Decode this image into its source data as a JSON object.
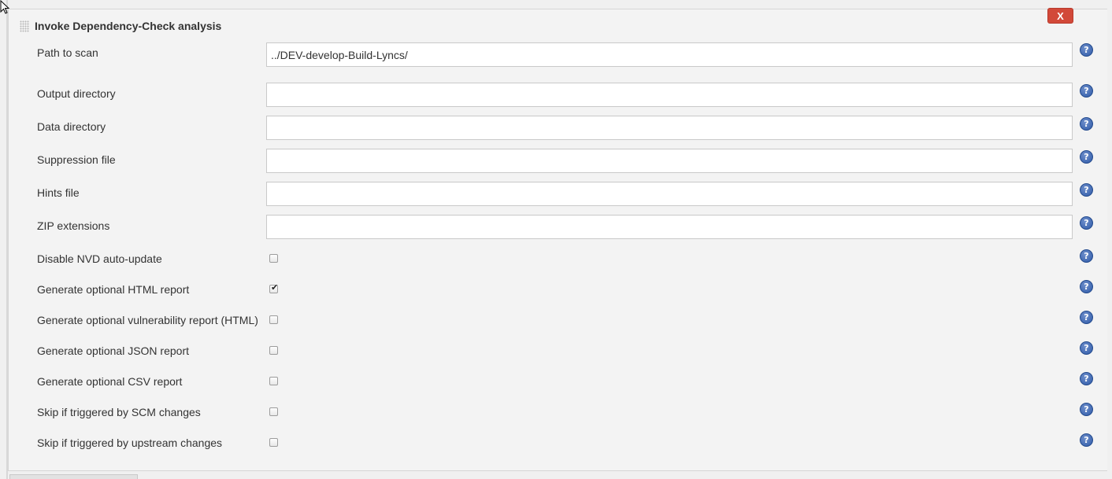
{
  "section": {
    "title": "Invoke Dependency-Check analysis",
    "delete_label": "X"
  },
  "text_fields": [
    {
      "label": "Path to scan",
      "value": "../DEV-develop-Build-Lyncs/"
    },
    {
      "label": "Output directory",
      "value": ""
    },
    {
      "label": "Data directory",
      "value": ""
    },
    {
      "label": "Suppression file",
      "value": ""
    },
    {
      "label": "Hints file",
      "value": ""
    },
    {
      "label": "ZIP extensions",
      "value": ""
    }
  ],
  "checkboxes": [
    {
      "label": "Disable NVD auto-update",
      "checked": false
    },
    {
      "label": "Generate optional HTML report",
      "checked": true
    },
    {
      "label": "Generate optional vulnerability report (HTML)",
      "checked": false
    },
    {
      "label": "Generate optional JSON report",
      "checked": false
    },
    {
      "label": "Generate optional CSV report",
      "checked": false
    },
    {
      "label": "Skip if triggered by SCM changes",
      "checked": false
    },
    {
      "label": "Skip if triggered by upstream changes",
      "checked": false
    }
  ],
  "help_glyph": "?",
  "colors": {
    "delete_button": "#d24939",
    "help_icon": "#2e5aa8"
  }
}
